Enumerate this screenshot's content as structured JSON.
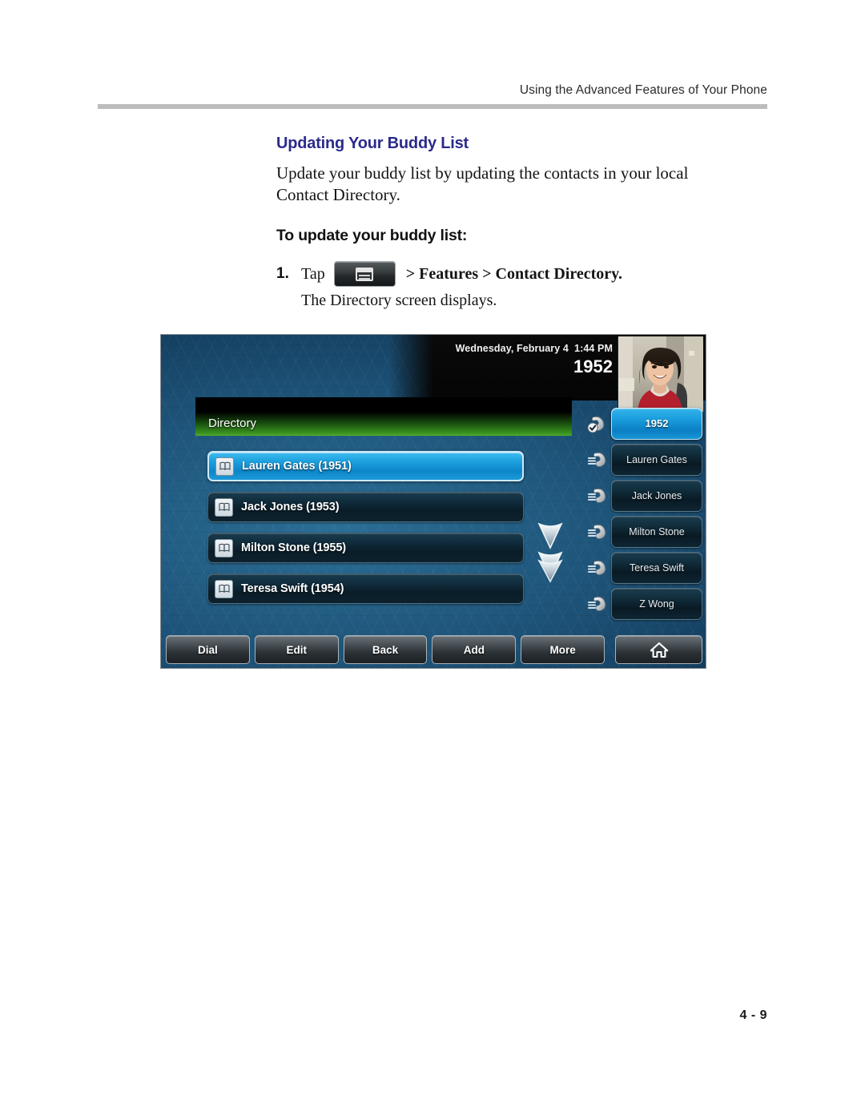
{
  "page": {
    "running_header": "Using the Advanced Features of Your Phone",
    "page_number": "4 - 9",
    "heading_color": "#2b2a8c"
  },
  "content": {
    "section_title": "Updating Your Buddy List",
    "intro_paragraph": "Update your buddy list by updating the contacts in your local Contact Directory.",
    "sub_heading": "To update your buddy list:",
    "step": {
      "number": "1.",
      "verb": "Tap",
      "key_icon": "menu-home-key-icon",
      "path": "> Features > Contact Directory.",
      "result": "The Directory screen displays."
    }
  },
  "phone": {
    "status": {
      "date": "Wednesday, February 4",
      "time": "1:44 PM",
      "extension": "1952"
    },
    "avatar": {
      "name": "user-photo"
    },
    "banner": {
      "title": "Directory"
    },
    "contacts": [
      {
        "icon": "contact-book-icon",
        "label": "Lauren Gates (1951)",
        "selected": true
      },
      {
        "icon": "contact-book-icon",
        "label": "Jack Jones (1953)",
        "selected": false
      },
      {
        "icon": "contact-book-icon",
        "label": "Milton Stone (1955)",
        "selected": false
      },
      {
        "icon": "contact-book-icon",
        "label": "Teresa Swift (1954)",
        "selected": false
      }
    ],
    "scroll_indicator": {
      "icon": "double-chevron-down-icon"
    },
    "line_keys": [
      {
        "icon": "handset-registered-icon",
        "label": "1952",
        "active": true
      },
      {
        "icon": "handset-presence-icon",
        "label": "Lauren Gates",
        "active": false
      },
      {
        "icon": "handset-presence-icon",
        "label": "Jack Jones",
        "active": false
      },
      {
        "icon": "handset-presence-icon",
        "label": "Milton Stone",
        "active": false
      },
      {
        "icon": "handset-presence-icon",
        "label": "Teresa Swift",
        "active": false
      },
      {
        "icon": "handset-presence-icon",
        "label": "Z Wong",
        "active": false
      }
    ],
    "soft_keys": [
      {
        "label": "Dial"
      },
      {
        "label": "Edit"
      },
      {
        "label": "Back"
      },
      {
        "label": "Add"
      },
      {
        "label": "More"
      }
    ],
    "home_key": {
      "icon": "home-icon",
      "label": ""
    },
    "colors": {
      "screen_blue": "#1d5277",
      "banner_green": "#3f9a22",
      "selected_blue": "#1ea2e0"
    }
  }
}
